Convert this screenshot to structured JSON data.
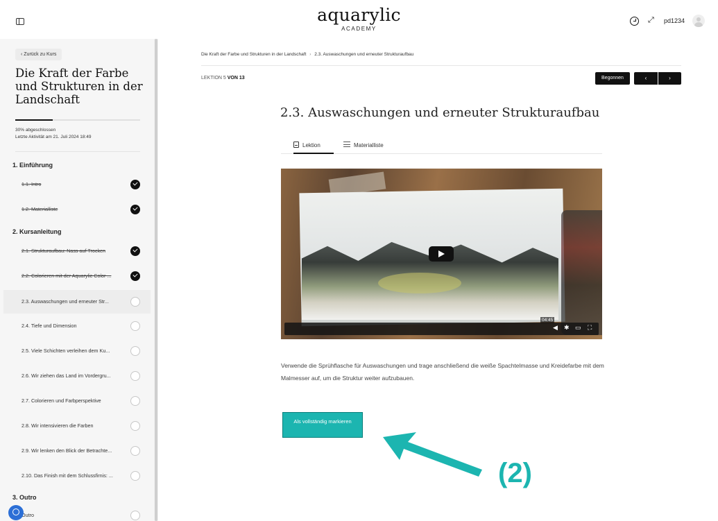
{
  "header": {
    "logo_main": "aquarylic",
    "logo_sub": "ACADEMY",
    "username": "pd1234"
  },
  "sidebar": {
    "back_label": "‹  Zurück zu Kurs",
    "course_title": "Die Kraft der Farbe und Strukturen in der Landschaft",
    "progress_fraction": 0.3,
    "progress_text": "30% abgeschlossen",
    "last_activity": "Letzte Aktivität am 21. Juli 2024 18:49",
    "sections": [
      {
        "title": "1. Einführung"
      },
      {
        "title": "2. Kursanleitung"
      },
      {
        "title": "3. Outro"
      }
    ],
    "lessons": [
      {
        "label": "1.1. Intro",
        "done": true
      },
      {
        "label": "1.2. Materialliste",
        "done": true
      },
      {
        "label": "2.1. Strukturaufbau: Nass auf Trocken",
        "done": true
      },
      {
        "label": "2.2. Colorieren mit der Aquarylic Color ...",
        "done": true
      },
      {
        "label": "2.3. Auswaschungen und erneuter Str...",
        "done": false
      },
      {
        "label": "2.4. Tiefe und Dimension",
        "done": false
      },
      {
        "label": "2.5. Viele Schichten verleihen dem Ku...",
        "done": false
      },
      {
        "label": "2.6. Wir ziehen das Land im Vordergru...",
        "done": false
      },
      {
        "label": "2.7. Colorieren und Farbperspektive",
        "done": false
      },
      {
        "label": "2.8. Wir intensivieren die Farben",
        "done": false
      },
      {
        "label": "2.9. Wir lenken den Blick der Betrachte...",
        "done": false
      },
      {
        "label": "2.10. Das Finish mit dem Schlussfirnis: ...",
        "done": false
      },
      {
        "label": "Outro",
        "done": false
      }
    ]
  },
  "main": {
    "breadcrumb_course": "Die Kraft der Farbe und Strukturen in der Landschaft",
    "breadcrumb_sep": "›",
    "breadcrumb_lesson": "2.3. Auswaschungen und erneuter Strukturaufbau",
    "counter_prefix": "LEKTION 5",
    "counter_suffix": "VON 13",
    "start_label": "Begonnen",
    "prev_label": "‹",
    "next_label": "›",
    "lesson_title": "2.3. Auswaschungen und erneuter Strukturaufbau",
    "tabs": [
      {
        "label": "Lektion"
      },
      {
        "label": "Materialliste"
      }
    ],
    "video_time": "04:45",
    "description": "Verwende die Sprühflasche für Auswaschungen und trage anschließend die weiße Spachtelmasse und Kreidefarbe mit dem Malmesser auf, um die Struktur weiter aufzubauen.",
    "complete_label": "Als vollständig markieren"
  },
  "annotation": {
    "label": "(2)",
    "color": "#1cb5b0"
  }
}
